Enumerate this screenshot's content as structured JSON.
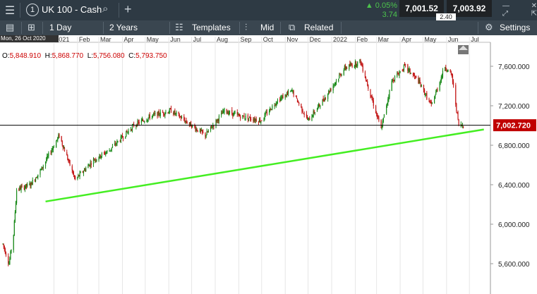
{
  "window": {
    "title": "UK 100 - Cash",
    "instrument_number": "1",
    "change_percent": "0.05%",
    "change_points": "3.74",
    "bid": "7,001.52",
    "ask": "7,003.92",
    "spread": "2.40"
  },
  "toolbar": {
    "interval": "1 Day",
    "range": "2 Years",
    "templates": "Templates",
    "price_type": "Mid",
    "related": "Related",
    "settings": "Settings"
  },
  "cursor": {
    "date": "Mon, 26 Oct 2020",
    "ohlc_labels": [
      "O:",
      "H:",
      "L:",
      "C:"
    ],
    "open": "5,848.910",
    "high": "5,868.770",
    "low": "5,756.080",
    "close": "5,793.750"
  },
  "colors": {
    "up": "#1a8a1a",
    "down": "#c41a1a",
    "trendline": "#44ee22",
    "price_badge": "#c00000",
    "toolbar_bg": "#3a4650",
    "topbar_bg": "#2e3a44"
  },
  "chart_data": {
    "type": "candlestick",
    "x_ticks": [
      "2021",
      "Feb",
      "Mar",
      "Apr",
      "May",
      "Jun",
      "Jul",
      "Aug",
      "Sep",
      "Oct",
      "Nov",
      "Dec",
      "2022",
      "Feb",
      "Mar",
      "Apr",
      "May",
      "Jun",
      "Jul"
    ],
    "y_ticks": [
      "7,600.000",
      "7,200.000",
      "6,800.000",
      "6,400.000",
      "6,000.000",
      "5,600.000"
    ],
    "y_tick_values": [
      7600,
      7200,
      6800,
      6400,
      6000,
      5600
    ],
    "ylim": [
      5470,
      7780
    ],
    "current_price": "7,002.720",
    "current_price_value": 7002.72,
    "trendline": {
      "start": [
        "2020-12-21",
        6230
      ],
      "end": [
        "2022-07-20",
        6960
      ]
    },
    "series_anchor_points": [
      [
        "2020-10-26",
        5800
      ],
      [
        "2020-11-03",
        5600
      ],
      [
        "2020-11-09",
        5900
      ],
      [
        "2020-11-13",
        6350
      ],
      [
        "2020-12-01",
        6400
      ],
      [
        "2020-12-15",
        6550
      ],
      [
        "2021-01-08",
        6900
      ],
      [
        "2021-01-29",
        6450
      ],
      [
        "2021-02-22",
        6650
      ],
      [
        "2021-03-15",
        6750
      ],
      [
        "2021-04-16",
        7000
      ],
      [
        "2021-05-10",
        7100
      ],
      [
        "2021-06-04",
        7150
      ],
      [
        "2021-07-19",
        6900
      ],
      [
        "2021-08-13",
        7150
      ],
      [
        "2021-08-31",
        7100
      ],
      [
        "2021-09-30",
        7050
      ],
      [
        "2021-10-21",
        7250
      ],
      [
        "2021-11-10",
        7350
      ],
      [
        "2021-12-01",
        7050
      ],
      [
        "2021-12-20",
        7250
      ],
      [
        "2022-01-18",
        7580
      ],
      [
        "2022-02-08",
        7650
      ],
      [
        "2022-03-07",
        6960
      ],
      [
        "2022-03-21",
        7450
      ],
      [
        "2022-04-07",
        7600
      ],
      [
        "2022-04-25",
        7450
      ],
      [
        "2022-05-12",
        7200
      ],
      [
        "2022-05-30",
        7600
      ],
      [
        "2022-06-08",
        7500
      ],
      [
        "2022-06-17",
        7000
      ],
      [
        "2022-06-23",
        7000
      ]
    ],
    "grid": false,
    "legend": "none"
  }
}
